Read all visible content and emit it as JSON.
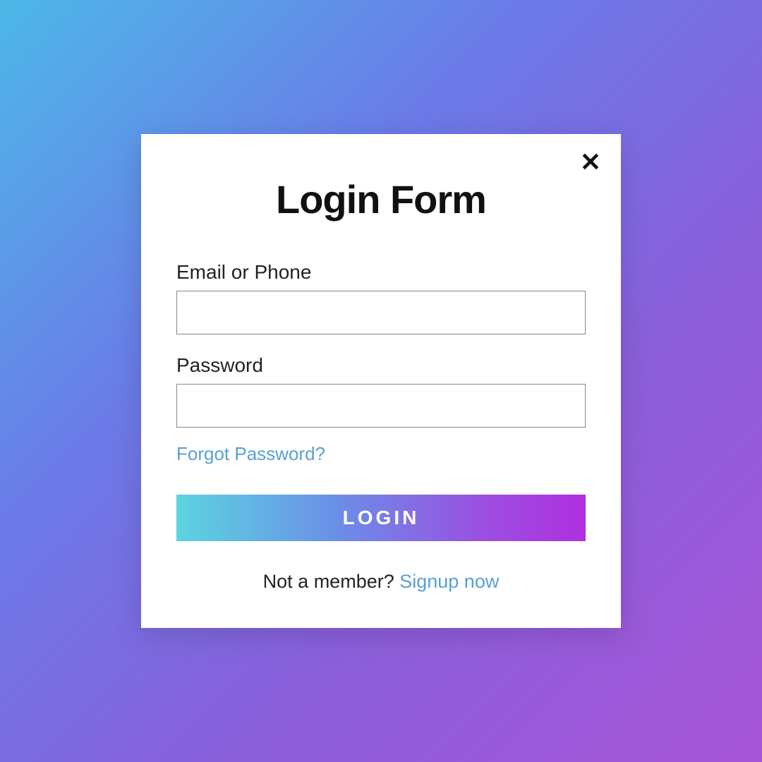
{
  "form": {
    "title": "Login Form",
    "close_icon": "✕",
    "fields": {
      "identity": {
        "label": "Email or Phone",
        "value": ""
      },
      "password": {
        "label": "Password",
        "value": ""
      }
    },
    "forgot_link": "Forgot Password?",
    "submit_label": "LOGIN",
    "signup_prompt": "Not a member? ",
    "signup_link": "Signup now"
  },
  "colors": {
    "accent_link": "#5a9fd4",
    "bg_gradient_start": "#4db8e8",
    "bg_gradient_end": "#a855d8",
    "button_gradient_start": "#5bd5e0",
    "button_gradient_end": "#b030e0"
  }
}
